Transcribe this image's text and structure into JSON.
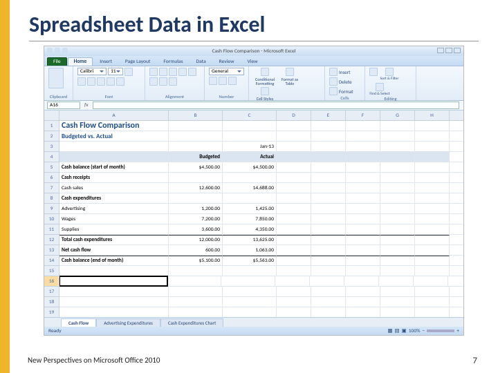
{
  "slide": {
    "title": "Spreadsheet Data in Excel",
    "footer": "New Perspectives on Microsoft Office 2010",
    "page_number": "7"
  },
  "excel": {
    "window_title": "Cash Flow Comparison - Microsoft Excel",
    "tabs": [
      "File",
      "Home",
      "Insert",
      "Page Layout",
      "Formulas",
      "Data",
      "Review",
      "View"
    ],
    "active_tab": "Home",
    "ribbon_groups": {
      "clipboard": "Clipboard",
      "font": "Font",
      "alignment": "Alignment",
      "number": "Number",
      "styles": "Styles",
      "cells": "Cells",
      "editing": "Editing"
    },
    "font": {
      "name": "Calibri",
      "size": "11",
      "number_format": "General"
    },
    "style_buttons": {
      "conditional": "Conditional Formatting",
      "format_table": "Format as Table",
      "cell_styles": "Cell Styles"
    },
    "cell_buttons": {
      "insert": "Insert",
      "delete": "Delete",
      "format": "Format"
    },
    "editing_buttons": {
      "sort": "Sort & Filter",
      "find": "Find & Select"
    },
    "namebox": "A16",
    "columns": [
      "A",
      "B",
      "C",
      "D",
      "E",
      "F",
      "G",
      "H"
    ],
    "sheet": {
      "title": "Cash Flow Comparison",
      "subtitle": "Budgeted vs. Actual",
      "period": "Jan-13",
      "col_budgeted": "Budgeted",
      "col_actual": "Actual",
      "rows": {
        "r5_label": "Cash balance (start of month)",
        "r5_b": "$4,500.00",
        "r5_a": "$4,500.00",
        "r6_label": "Cash receipts",
        "r7_label": "   Cash sales",
        "r7_b": "12,600.00",
        "r7_a": "14,688.00",
        "r8_label": "Cash expenditures",
        "r9_label": "   Advertising",
        "r9_b": "1,200.00",
        "r9_a": "1,425.00",
        "r10_label": "   Wages",
        "r10_b": "7,200.00",
        "r10_a": "7,850.00",
        "r11_label": "   Supplies",
        "r11_b": "3,600.00",
        "r11_a": "4,350.00",
        "r12_label": "Total cash expenditures",
        "r12_b": "12,000.00",
        "r12_a": "13,625.00",
        "r13_label": "Net cash flow",
        "r13_b": "600.00",
        "r13_a": "1,063.00",
        "r14_label": "Cash balance (end of month)",
        "r14_b": "$5,100.00",
        "r14_a": "$5,563.00"
      }
    },
    "sheet_tabs": [
      "Cash Flow",
      "Advertising Expenditures",
      "Cash Expenditures Chart"
    ],
    "status": "Ready",
    "zoom": "100%"
  }
}
